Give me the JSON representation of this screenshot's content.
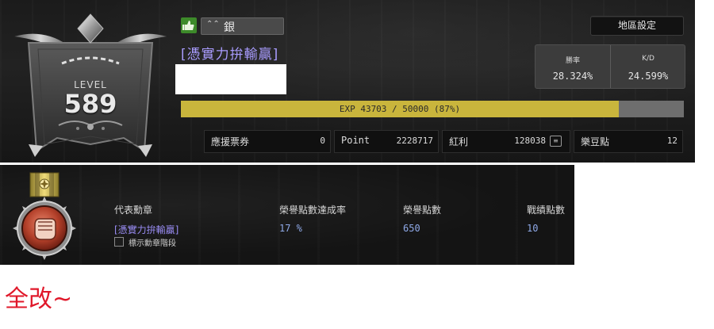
{
  "profile": {
    "level_label": "LEVEL",
    "level_value": "589",
    "rank_icon": "rank-chevron-icon",
    "rank_name": "銀",
    "title_tag": "[憑實力拚輸贏]",
    "region_button": "地區設定",
    "stats": {
      "winrate_label": "勝率",
      "winrate_value": "28.324%",
      "kd_label": "K/D",
      "kd_value": "24.599%"
    },
    "exp": {
      "text": "EXP 43703 / 50000 (87%)",
      "fraction": 0.87
    },
    "currencies": [
      {
        "label": "應援票券",
        "value": "0"
      },
      {
        "label": "Point",
        "value": "2228717"
      },
      {
        "label": "紅利",
        "value": "128038"
      },
      {
        "label": "樂豆點",
        "value": "12"
      }
    ]
  },
  "medal": {
    "rep_medal_label": "代表勳章",
    "rep_medal_value": "[憑實力拚輸贏]",
    "show_stage_label": "標示勳章階段",
    "achievement_rate_label": "榮譽點數達成率",
    "achievement_rate_value": "17 %",
    "honor_points_label": "榮譽點數",
    "honor_points_value": "650",
    "record_points_label": "戰績點數",
    "record_points_value": "10"
  },
  "footer_note": "全改~",
  "colors": {
    "exp_fill": "#c9b53c",
    "title_purple": "#a99cff",
    "value_blue": "#8fa9e8",
    "footer_red": "#e0182a",
    "like_green": "#3d8a2a"
  }
}
